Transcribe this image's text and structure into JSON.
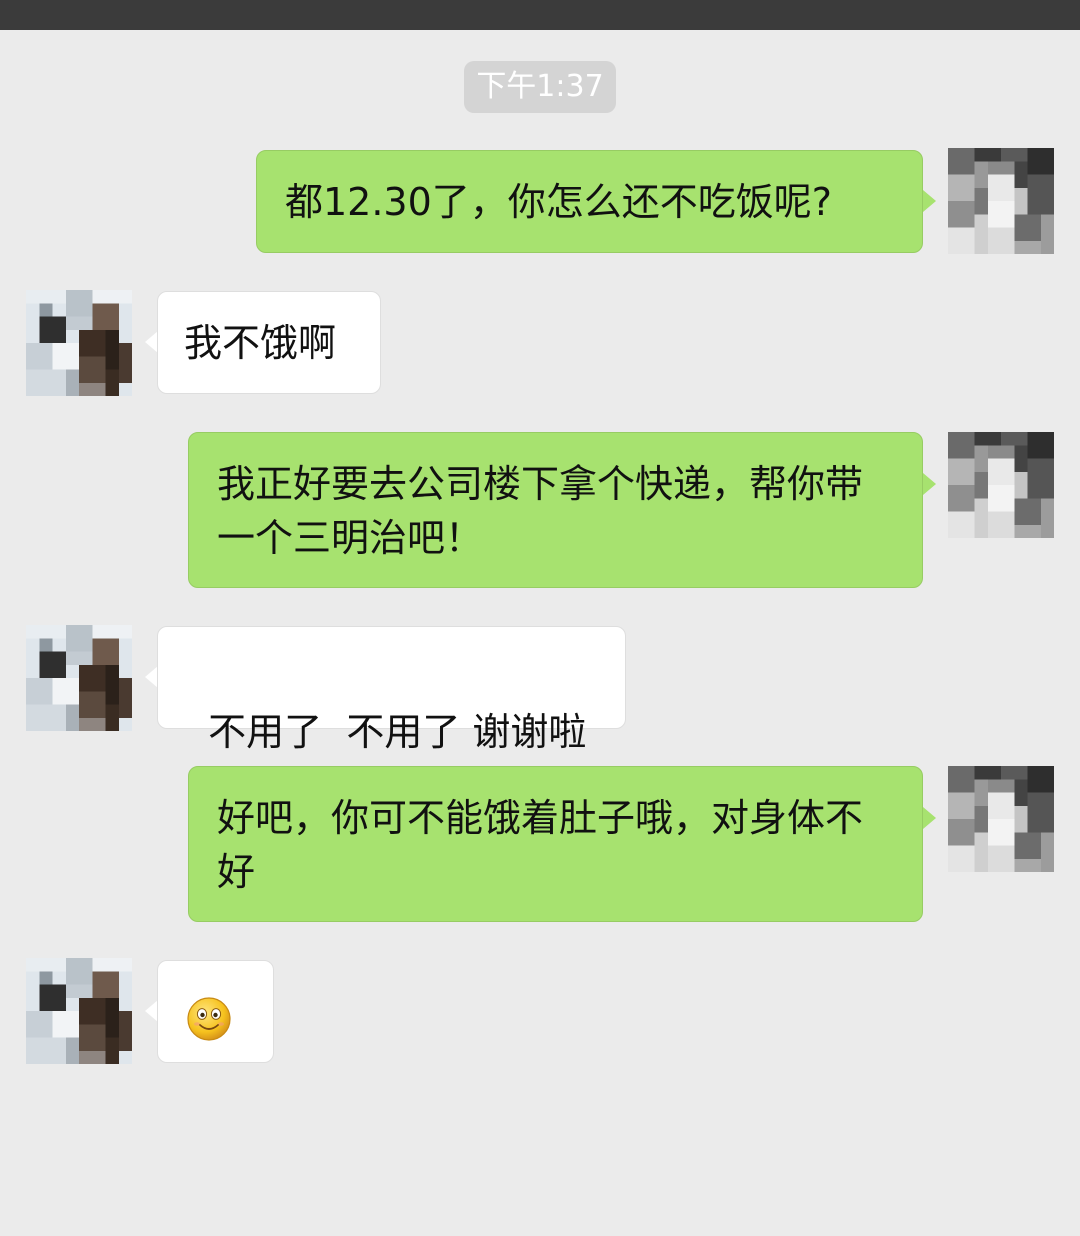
{
  "chat": {
    "timestamp": "下午1:37",
    "messages": [
      {
        "side": "out",
        "text": "都12.30了，你怎么还不吃饭呢?"
      },
      {
        "side": "in",
        "text": "我不饿啊"
      },
      {
        "side": "out",
        "text": "我正好要去公司楼下拿个快递，帮你带一个三明治吧！"
      },
      {
        "side": "in",
        "text": "不用了  不用了 谢谢啦"
      },
      {
        "side": "out",
        "text": "好吧，你可不能饿着肚子哦，对身体不好"
      },
      {
        "side": "in",
        "icon": "smiley-emoji-icon"
      }
    ]
  },
  "colors": {
    "outgoing_bubble": "#a7e26f",
    "incoming_bubble": "#ffffff",
    "background": "#ebebeb",
    "status_bar": "#3b3b3b"
  }
}
